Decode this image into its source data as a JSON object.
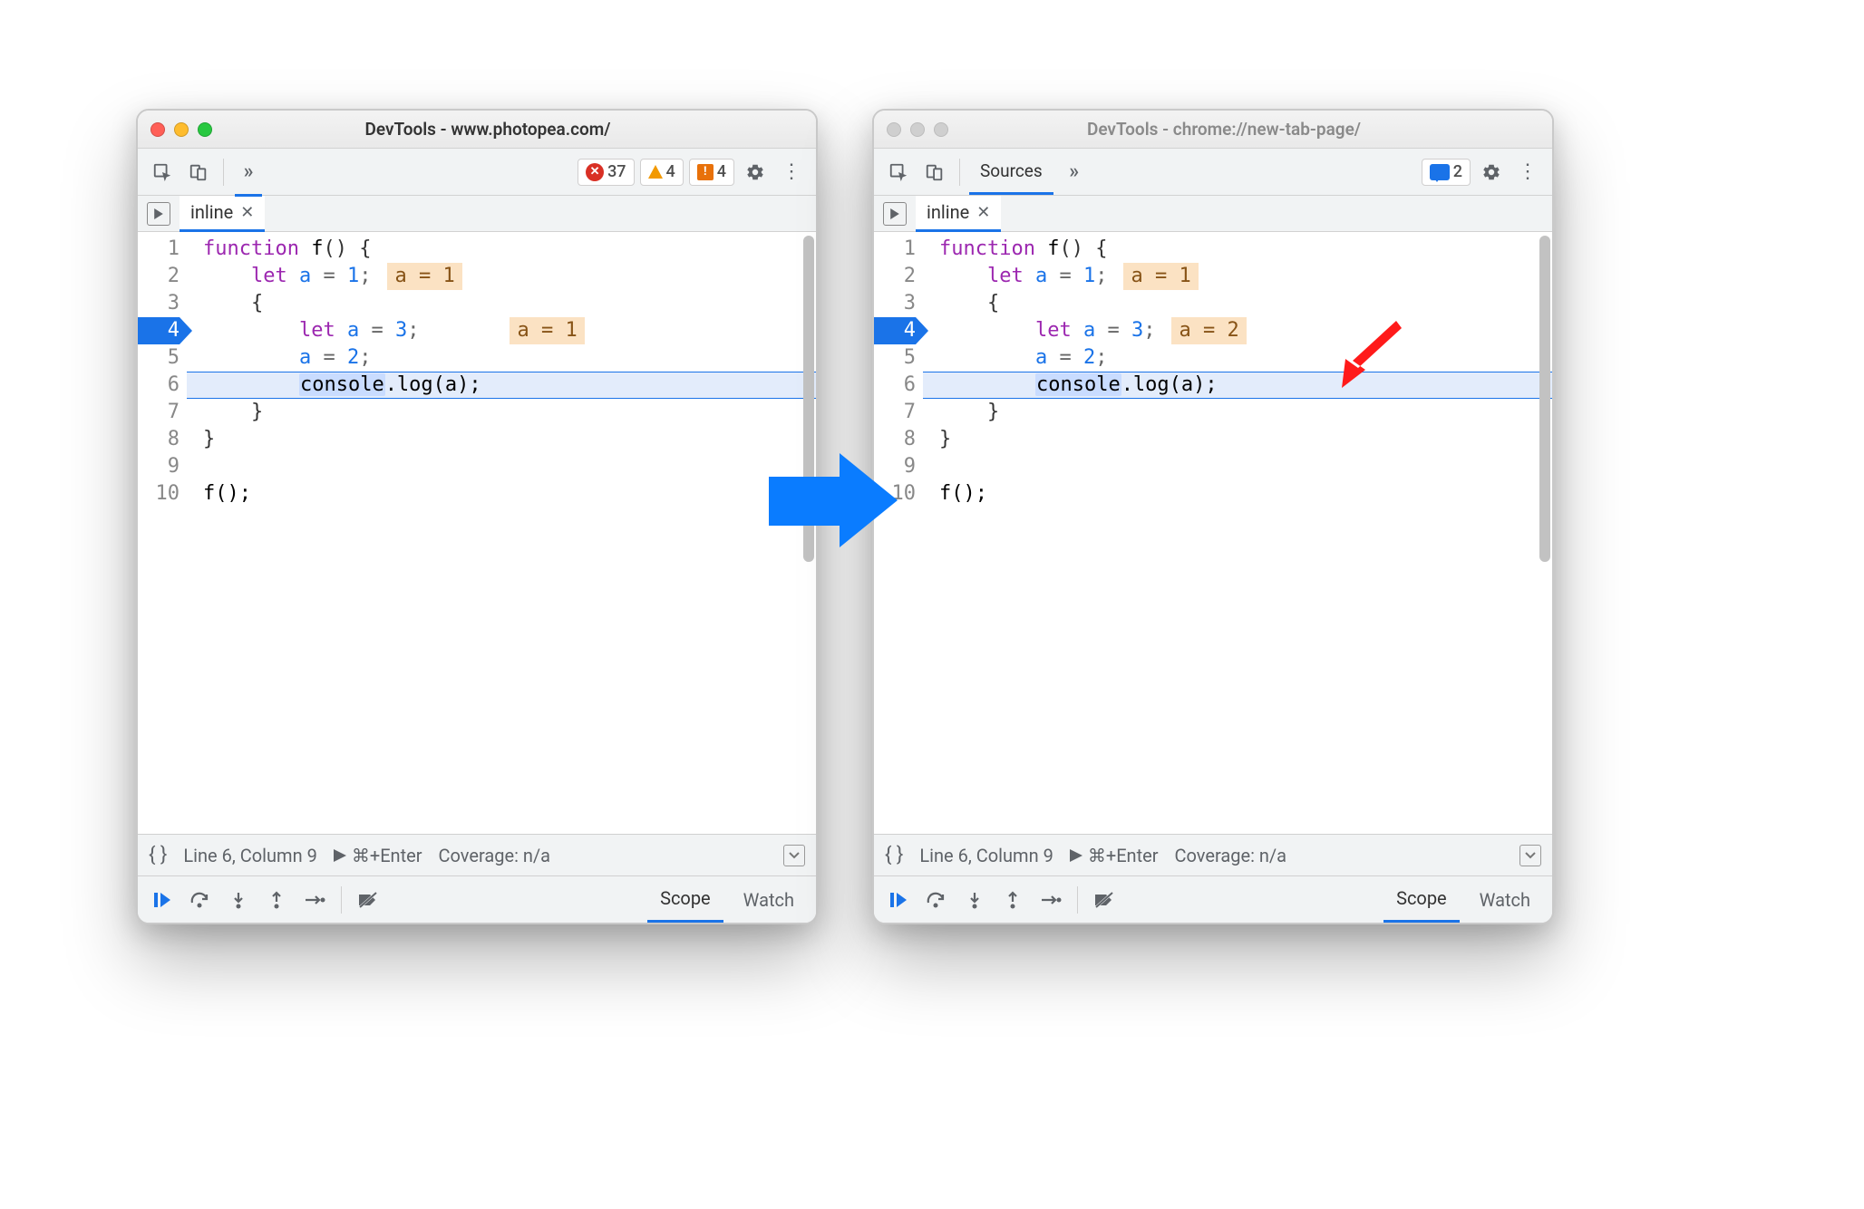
{
  "windows": {
    "left": {
      "title": "DevTools - www.photopea.com/",
      "active": true,
      "toolbar": {
        "errors_count": "37",
        "warnings_count": "4",
        "issues_count": "4"
      },
      "tab_label": "inline",
      "code": {
        "lines": [
          "1",
          "2",
          "3",
          "4",
          "5",
          "6",
          "7",
          "8",
          "9",
          "10"
        ],
        "src": {
          "l1_kw": "function",
          "l1_fn": " f",
          "l1_rest": "() {",
          "l2_kw": "let",
          "l2_id": " a",
          "l2_rest": " = ",
          "l2_num": "1",
          "l2_semi": ";",
          "l3": "{",
          "l4_kw": "let",
          "l4_id": " a",
          "l4_rest": " = ",
          "l4_num": "3",
          "l4_semi": ";",
          "l5_id": "a",
          "l5_rest": " = ",
          "l5_num": "2",
          "l5_semi": ";",
          "l6_sel": "console",
          "l6_rest": ".log(a);",
          "l7": "}",
          "l8": "}",
          "l10": "f();"
        },
        "mem_l2": "a = 1",
        "mem_l4": "a = 1"
      },
      "status": {
        "position": "Line 6, Column 9",
        "run": "⌘+Enter",
        "coverage": "Coverage: n/a"
      },
      "debug_tabs": {
        "scope": "Scope",
        "watch": "Watch"
      }
    },
    "right": {
      "title": "DevTools - chrome://new-tab-page/",
      "active": false,
      "toolbar": {
        "sources_label": "Sources",
        "messages_count": "2"
      },
      "tab_label": "inline",
      "code": {
        "lines": [
          "1",
          "2",
          "3",
          "4",
          "5",
          "6",
          "7",
          "8",
          "9",
          "10"
        ],
        "src": {
          "l1_kw": "function",
          "l1_fn": " f",
          "l1_rest": "() {",
          "l2_kw": "let",
          "l2_id": " a",
          "l2_rest": " = ",
          "l2_num": "1",
          "l2_semi": ";",
          "l3": "{",
          "l4_kw": "let",
          "l4_id": " a",
          "l4_rest": " = ",
          "l4_num": "3",
          "l4_semi": ";",
          "l5_id": "a",
          "l5_rest": " = ",
          "l5_num": "2",
          "l5_semi": ";",
          "l6_sel": "console",
          "l6_rest": ".log(a);",
          "l7": "}",
          "l8": "}",
          "l10": "f();"
        },
        "mem_l2": "a = 1",
        "mem_l4": "a = 2"
      },
      "status": {
        "position": "Line 6, Column 9",
        "run": "⌘+Enter",
        "coverage": "Coverage: n/a"
      },
      "debug_tabs": {
        "scope": "Scope",
        "watch": "Watch"
      }
    }
  }
}
